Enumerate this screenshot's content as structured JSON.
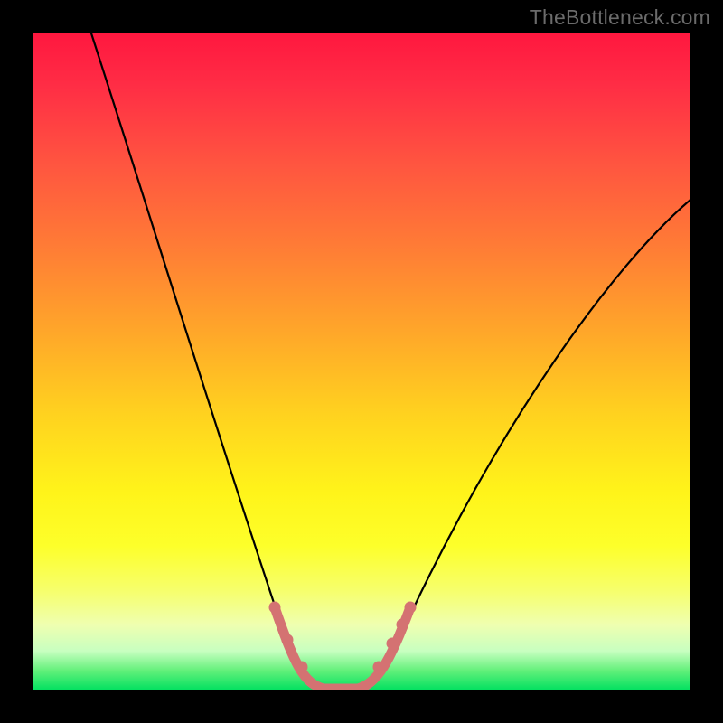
{
  "watermark": {
    "text": "TheBottleneck.com"
  },
  "colors": {
    "frame": "#000000",
    "curve": "#000000",
    "valley_marker": "#d47272",
    "gradient_top": "#ff173f",
    "gradient_bottom": "#00e060"
  },
  "chart_data": {
    "type": "line",
    "title": "",
    "xlabel": "",
    "ylabel": "",
    "xlim": [
      0,
      100
    ],
    "ylim": [
      0,
      100
    ],
    "grid": false,
    "legend": false,
    "series": [
      {
        "name": "bottleneck-curve",
        "x": [
          0,
          5,
          10,
          15,
          20,
          25,
          30,
          35,
          38,
          40,
          42,
          44,
          46,
          48,
          50,
          55,
          60,
          65,
          70,
          75,
          80,
          85,
          90,
          95,
          100
        ],
        "y": [
          105,
          93,
          80,
          68,
          56,
          44,
          32,
          20,
          11,
          6,
          2,
          0,
          0,
          0,
          2,
          6,
          13,
          21,
          29,
          37,
          44,
          51,
          57,
          62,
          67
        ]
      },
      {
        "name": "valley-marker",
        "x": [
          37,
          38.5,
          40,
          42,
          44,
          46,
          48,
          50,
          51.5,
          53
        ],
        "y": [
          11,
          6,
          3,
          1,
          0,
          0,
          1,
          3,
          6,
          11
        ]
      }
    ]
  }
}
